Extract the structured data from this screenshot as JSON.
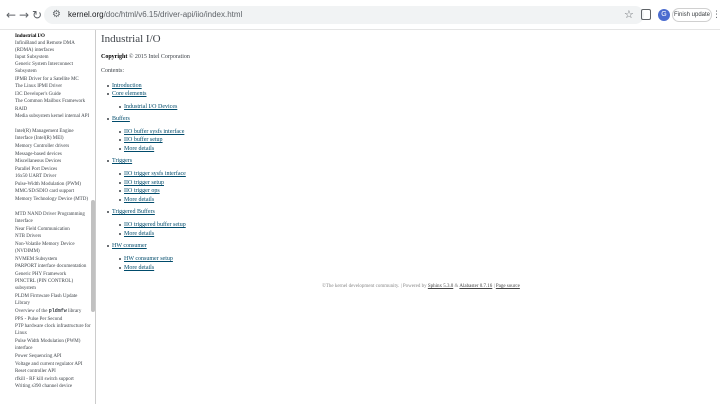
{
  "browser": {
    "url_host": "kernel.org",
    "url_path": "/doc/html/v6.15/driver-api/iio/index.html",
    "finish_update": "Finish update",
    "profile_initial": "G"
  },
  "sidebar": {
    "items": [
      {
        "label": "Industrial I/O"
      },
      {
        "label": "InfiniBand and Remote DMA (RDMA) interfaces"
      },
      {
        "label": "Input Subsystem"
      },
      {
        "label": "Generic System Interconnect Subsystem"
      },
      {
        "label": "IPMB Driver for a Satellite MC"
      },
      {
        "label": "The Linux IPMI Driver"
      },
      {
        "label": "I3C Developer's Guide"
      },
      {
        "label": "The Common Mailbox Framework"
      },
      {
        "label": "RAID"
      },
      {
        "label": "Media subsystem kernel internal API"
      },
      {
        "label": "Intel(R) Management Engine Interface (Intel(R) MEI)"
      },
      {
        "label": "Memory Controller drivers"
      },
      {
        "label": "Message-based devices"
      },
      {
        "label": "Miscellaneous Devices"
      },
      {
        "label": "Parallel Port Devices"
      },
      {
        "label": "16x50 UART Driver"
      },
      {
        "label": "Pulse-Width Modulation (PWM)"
      },
      {
        "label": "MMC/SD/SDIO card support"
      },
      {
        "label": "Memory Technology Device (MTD)"
      },
      {
        "label": "MTD NAND Driver Programming Interface"
      },
      {
        "label": "Near Field Communication"
      },
      {
        "label": "NTB Drivers"
      },
      {
        "label": "Non-Volatile Memory Device (NVDIMM)"
      },
      {
        "label": "NVMEM Subsystem"
      },
      {
        "label": "PARPORT interface documentation"
      },
      {
        "label": "Generic PHY Framework"
      },
      {
        "label": "PINCTRL (PIN CONTROL) subsystem"
      },
      {
        "label": "PLDM Firmware Flash Update Library"
      },
      {
        "label_pre": "Overview of the ",
        "label_mono": "pldmfw",
        "label_post": " library"
      },
      {
        "label": "PPS - Pulse Per Second"
      },
      {
        "label": "PTP hardware clock infrastructure for Linux"
      },
      {
        "label": "Pulse Width Modulation (PWM) interface"
      },
      {
        "label": "Power Sequencing API"
      },
      {
        "label": "Voltage and current regulator API"
      },
      {
        "label": "Reset controller API"
      },
      {
        "label": "rfkill - RF kill switch support"
      },
      {
        "label": "Writing s390 channel device"
      }
    ]
  },
  "main": {
    "title": "Industrial I/O",
    "copyright_label": "Copyright",
    "copyright_text": "© 2015 Intel Corporation",
    "contents_label": "Contents:",
    "toc": [
      {
        "label": "Introduction",
        "level": 1
      },
      {
        "label": "Core elements",
        "level": 1
      },
      {
        "label": "Industrial I/O Devices",
        "level": 2
      },
      {
        "label": "Buffers",
        "level": 1
      },
      {
        "label": "IIO buffer sysfs interface",
        "level": 2
      },
      {
        "label": "IIO buffer setup",
        "level": 2
      },
      {
        "label": "More details",
        "level": 2
      },
      {
        "label": "Triggers",
        "level": 1
      },
      {
        "label": "IIO trigger sysfs interface",
        "level": 2
      },
      {
        "label": "IIO trigger setup",
        "level": 2
      },
      {
        "label": "IIO trigger ops",
        "level": 2
      },
      {
        "label": "More details",
        "level": 2
      },
      {
        "label": "Triggered Buffers",
        "level": 1
      },
      {
        "label": "IIO triggered buffer setup",
        "level": 2
      },
      {
        "label": "More details",
        "level": 2
      },
      {
        "label": "HW consumer",
        "level": 1
      },
      {
        "label": "HW consumer setup",
        "level": 2
      },
      {
        "label": "More details",
        "level": 2
      }
    ],
    "footer": {
      "prefix": "©The kernel development community. | Powered by ",
      "sphinx": "Sphinx 5.3.0",
      "and": " & ",
      "alabaster": "Alabaster 0.7.16",
      "sep": " | ",
      "source": "Page source"
    }
  }
}
